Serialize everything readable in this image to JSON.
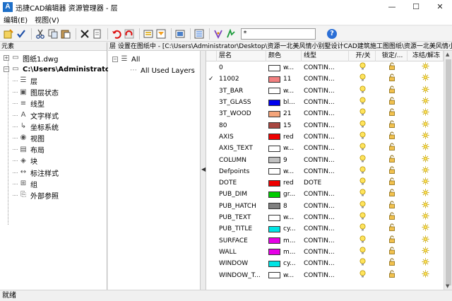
{
  "window": {
    "title": "迅捷CAD编辑器 资源管理器 - 层",
    "controls": {
      "minimize": "—",
      "maximize": "☐",
      "close": "✕"
    }
  },
  "menu": {
    "items": [
      "编辑(E)",
      "视图(V)"
    ]
  },
  "toolbar": {
    "filter_value": "*",
    "icons": [
      "new-layer-icon",
      "set-current-icon",
      "cut-icon",
      "copy-icon",
      "paste-icon",
      "delete-icon",
      "copy-page-icon",
      "undo-red-icon",
      "redo-red-icon",
      "layer-props-icon",
      "layer-filter-icon",
      "image-icon",
      "layer-manager-icon",
      "move-icon",
      "select-icon"
    ]
  },
  "left_panel": {
    "title": "元素",
    "tree": [
      {
        "label": "图纸1.dwg",
        "expander": "+",
        "icon": "▭",
        "level": 0,
        "bold": false
      },
      {
        "label": "C:\\Users\\Administrator\\D",
        "expander": "−",
        "icon": "▭",
        "level": 0,
        "bold": true
      },
      {
        "label": "层",
        "icon": "☰",
        "level": 1
      },
      {
        "label": "图层状态",
        "icon": "▣",
        "level": 1
      },
      {
        "label": "线型",
        "icon": "≡",
        "level": 1
      },
      {
        "label": "文字样式",
        "icon": "A",
        "level": 1
      },
      {
        "label": "坐标系统",
        "icon": "↳",
        "level": 1
      },
      {
        "label": "视图",
        "icon": "◉",
        "level": 1
      },
      {
        "label": "布局",
        "icon": "▤",
        "level": 1
      },
      {
        "label": "块",
        "icon": "◈",
        "level": 1
      },
      {
        "label": "标注样式",
        "icon": "↔",
        "level": 1
      },
      {
        "label": "组",
        "icon": "⊞",
        "level": 1
      },
      {
        "label": "外部参照",
        "icon": "⎘",
        "level": 1
      }
    ]
  },
  "middle_panel": {
    "header": "层 设置在图纸中 - [C:\\Users\\Administrator\\Desktop\\资源一北美风情小别墅设计CAD建筑施工图图纸\\资源一北美风情小别",
    "filters": [
      {
        "label": "All",
        "expander": "−"
      },
      {
        "label": "All Used Layers",
        "expander": ""
      }
    ]
  },
  "layers_table": {
    "columns": [
      "",
      "层名",
      "颜色",
      "线型",
      "开/关",
      "锁定/...",
      "冻结/解冻"
    ],
    "rows": [
      {
        "current": "",
        "name": "0",
        "color": "w...",
        "swatch": "#ffffff",
        "linetype": "CONTIN..."
      },
      {
        "current": "✓",
        "name": "11002",
        "color": "11",
        "swatch": "#f28080",
        "linetype": "CONTIN..."
      },
      {
        "current": "",
        "name": "3T_BAR",
        "color": "w...",
        "swatch": "#ffffff",
        "linetype": "CONTIN..."
      },
      {
        "current": "",
        "name": "3T_GLASS",
        "color": "bl...",
        "swatch": "#0000ee",
        "linetype": "CONTIN..."
      },
      {
        "current": "",
        "name": "3T_WOOD",
        "color": "21",
        "swatch": "#f4a479",
        "linetype": "CONTIN..."
      },
      {
        "current": "",
        "name": "80",
        "color": "15",
        "swatch": "#a84640",
        "linetype": "CONTIN..."
      },
      {
        "current": "",
        "name": "AXIS",
        "color": "red",
        "swatch": "#ee0000",
        "linetype": "CONTIN..."
      },
      {
        "current": "",
        "name": "AXIS_TEXT",
        "color": "w...",
        "swatch": "#ffffff",
        "linetype": "CONTIN..."
      },
      {
        "current": "",
        "name": "COLUMN",
        "color": "9",
        "swatch": "#c0c0c0",
        "linetype": "CONTIN..."
      },
      {
        "current": "",
        "name": "Defpoints",
        "color": "w...",
        "swatch": "#ffffff",
        "linetype": "CONTIN..."
      },
      {
        "current": "",
        "name": "DOTE",
        "color": "red",
        "swatch": "#ee0000",
        "linetype": "DOTE"
      },
      {
        "current": "",
        "name": "PUB_DIM",
        "color": "gr...",
        "swatch": "#00cc00",
        "linetype": "CONTIN..."
      },
      {
        "current": "",
        "name": "PUB_HATCH",
        "color": "8",
        "swatch": "#808080",
        "linetype": "CONTIN..."
      },
      {
        "current": "",
        "name": "PUB_TEXT",
        "color": "w...",
        "swatch": "#ffffff",
        "linetype": "CONTIN..."
      },
      {
        "current": "",
        "name": "PUB_TITLE",
        "color": "cy...",
        "swatch": "#00e5e5",
        "linetype": "CONTIN..."
      },
      {
        "current": "",
        "name": "SURFACE",
        "color": "m...",
        "swatch": "#e600e6",
        "linetype": "CONTIN..."
      },
      {
        "current": "",
        "name": "WALL",
        "color": "m...",
        "swatch": "#e600e6",
        "linetype": "CONTIN..."
      },
      {
        "current": "",
        "name": "WINDOW",
        "color": "cy...",
        "swatch": "#00e5e5",
        "linetype": "CONTIN..."
      },
      {
        "current": "",
        "name": "WINDOW_T...",
        "color": "w...",
        "swatch": "#ffffff",
        "linetype": "CONTIN..."
      }
    ]
  },
  "status": {
    "text": "就绪"
  }
}
